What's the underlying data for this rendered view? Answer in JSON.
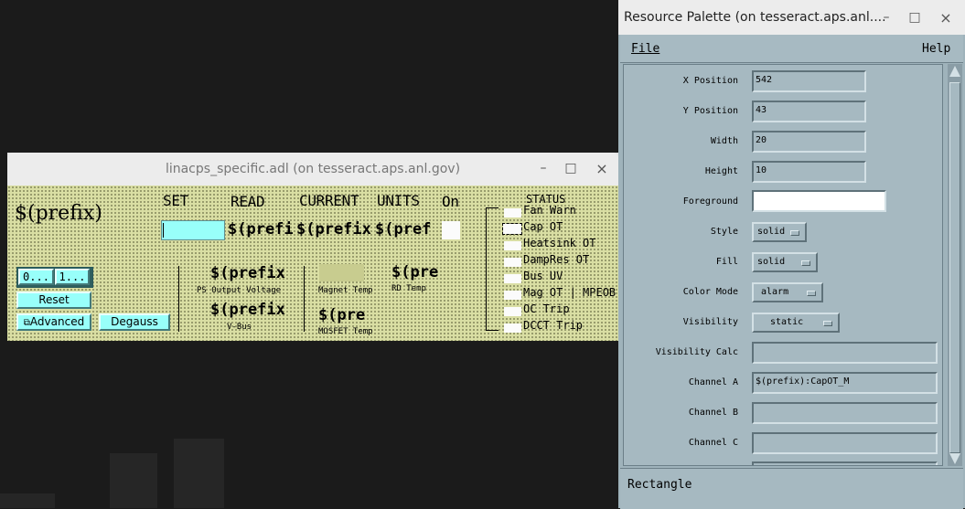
{
  "adl_window": {
    "title": "linacps_specific.adl (on tesseract.aps.anl.gov)",
    "controls": {
      "minimize": "–",
      "maximize": "□",
      "close": "×"
    },
    "prefix_title": "$(prefix)",
    "headers": {
      "set": "SET",
      "read": "READ",
      "current": "CURRENT",
      "units": "UNITS",
      "on": "On"
    },
    "pv_row": {
      "read": "$(prefi",
      "current": "$(prefix",
      "units": "$(pref"
    },
    "mode_buttons": [
      "0...",
      "1..."
    ],
    "reset_label": "Reset",
    "advanced_label": "Advanced",
    "degauss_label": "Degauss",
    "ps_output_voltage": {
      "value": "$(prefix",
      "label": "PS Output Voltage"
    },
    "v_bus": {
      "value": "$(prefix",
      "label": "V-Bus"
    },
    "magnet_temp_label": "Magnet Temp",
    "mosfet_temp": {
      "value": "$(pre",
      "label": "MOSFET Temp"
    },
    "rd_temp": {
      "value": "$(pre",
      "label": "RD Temp"
    },
    "status_title": "STATUS",
    "status_items": [
      "Fan Warn",
      "Cap OT",
      "Heatsink OT",
      "DampRes OT",
      "Bus UV",
      "Mag OT | MPEOB",
      "OC Trip",
      "DCCT Trip"
    ],
    "colors": {
      "background": "#d9dea3",
      "controls": "#98fffa"
    }
  },
  "resource_palette": {
    "title": "Resource Palette (on tesseract.aps.anl....",
    "controls": {
      "minimize": "–",
      "maximize": "□",
      "close": "×"
    },
    "menu": {
      "file": "File",
      "help": "Help"
    },
    "rows": [
      {
        "label": "X Position",
        "value": "542",
        "kind": "text"
      },
      {
        "label": "Y Position",
        "value": "43",
        "kind": "text"
      },
      {
        "label": "Width",
        "value": "20",
        "kind": "text"
      },
      {
        "label": "Height",
        "value": "10",
        "kind": "text"
      },
      {
        "label": "Foreground",
        "value": "",
        "kind": "color"
      },
      {
        "label": "Style",
        "value": "solid",
        "kind": "option"
      },
      {
        "label": "Fill",
        "value": "solid",
        "kind": "option"
      },
      {
        "label": "Color Mode",
        "value": "alarm",
        "kind": "option"
      },
      {
        "label": "Visibility",
        "value": "static",
        "kind": "option"
      },
      {
        "label": "Visibility Calc",
        "value": "",
        "kind": "text"
      },
      {
        "label": "Channel A",
        "value": "$(prefix):CapOT_M",
        "kind": "text"
      },
      {
        "label": "Channel B",
        "value": "",
        "kind": "text"
      },
      {
        "label": "Channel C",
        "value": "",
        "kind": "text"
      }
    ],
    "status": "Rectangle",
    "colors": {
      "panel": "#a6b9c1"
    }
  }
}
